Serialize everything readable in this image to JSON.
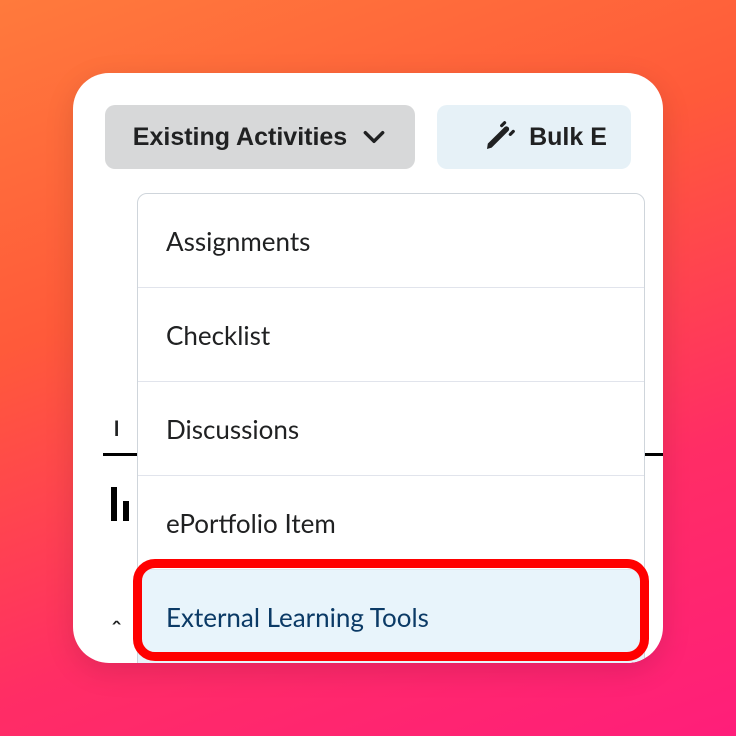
{
  "toolbar": {
    "existing_label": "Existing Activities",
    "bulk_label": "Bulk E"
  },
  "dropdown": {
    "items": [
      {
        "label": "Assignments",
        "highlighted": false
      },
      {
        "label": "Checklist",
        "highlighted": false
      },
      {
        "label": "Discussions",
        "highlighted": false
      },
      {
        "label": "ePortfolio Item",
        "highlighted": false
      },
      {
        "label": "External Learning Tools",
        "highlighted": true
      }
    ]
  },
  "colors": {
    "highlight_ring": "#ff0000",
    "highlight_bg": "#e8f4fb",
    "highlight_text": "#0b3a66"
  }
}
